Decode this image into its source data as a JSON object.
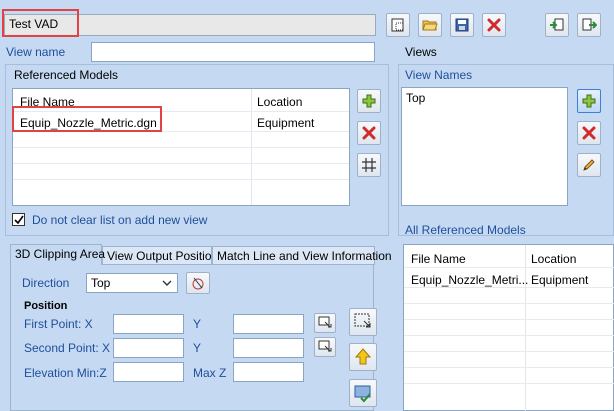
{
  "header": {
    "title_value": "Test VAD"
  },
  "view_name": {
    "label": "View name",
    "value": ""
  },
  "views_header": "Views",
  "referenced_models": {
    "section_label": "Referenced Models",
    "columns": [
      "File Name",
      "Location"
    ],
    "rows": [
      {
        "file": "Equip_Nozzle_Metric.dgn",
        "location": "Equipment"
      }
    ]
  },
  "view_names": {
    "label": "View Names",
    "items": [
      "Top"
    ]
  },
  "all_referenced_models": {
    "label": "All Referenced Models",
    "columns": [
      "File Name",
      "Location"
    ],
    "rows": [
      {
        "file": "Equip_Nozzle_Metri...",
        "location": "Equipment"
      }
    ]
  },
  "do_not_clear": {
    "label": "Do not clear list on add new view",
    "checked": true
  },
  "tabs": [
    "3D Clipping Area",
    "View Output Position",
    "Match Line and View Information"
  ],
  "clipping": {
    "direction_label": "Direction",
    "direction_value": "Top",
    "position_label": "Position",
    "first_point_label": "First Point: X",
    "second_point_label": "Second Point: X",
    "elevation_min_label": "Elevation Min:Z",
    "y_label": "Y",
    "max_z_label": "Max Z"
  },
  "icons": {
    "accent": "#e04343",
    "add": "plus-icon",
    "remove": "x-icon",
    "grid": "grid-icon",
    "edit": "pencil-icon"
  }
}
